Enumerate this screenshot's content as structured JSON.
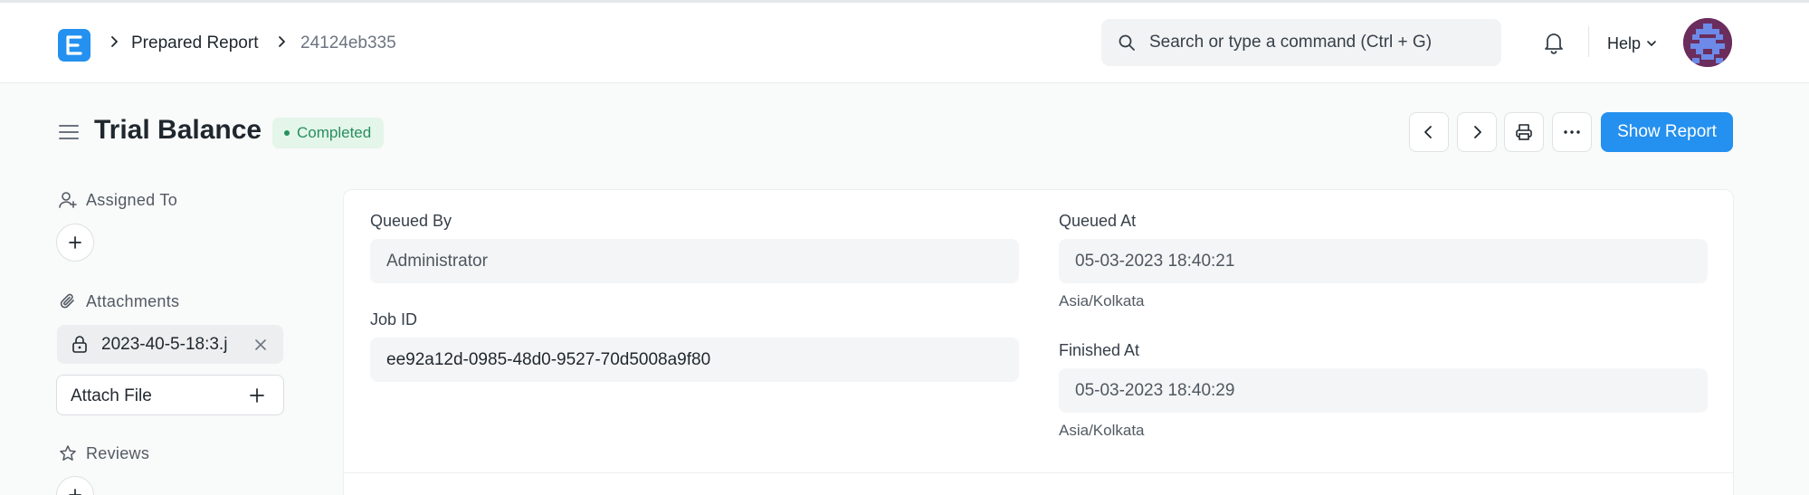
{
  "navbar": {
    "logo_letter": "E",
    "breadcrumbs": [
      "Prepared Report",
      "24124eb335"
    ],
    "search_placeholder": "Search or type a command (Ctrl + G)",
    "help_label": "Help",
    "accent": "#2490ef"
  },
  "page": {
    "title": "Trial Balance",
    "status": "Completed",
    "status_color": "#278f5e",
    "primary_action": "Show Report",
    "toolbar_icons": [
      "chevron-left-icon",
      "chevron-right-icon",
      "printer-icon",
      "more-horizontal-icon"
    ]
  },
  "sidebar": {
    "assigned_to_label": "Assigned To",
    "attachments_label": "Attachments",
    "attachment_name": "2023-40-5-18:3.j",
    "attach_file_label": "Attach File",
    "reviews_label": "Reviews"
  },
  "form": {
    "queued_by_label": "Queued By",
    "queued_by_value": "Administrator",
    "job_id_label": "Job ID",
    "job_id_value": "ee92a12d-0985-48d0-9527-70d5008a9f80",
    "queued_at_label": "Queued At",
    "queued_at_value": "05-03-2023 18:40:21",
    "queued_at_tz": "Asia/Kolkata",
    "finished_at_label": "Finished At",
    "finished_at_value": "05-03-2023 18:40:29",
    "finished_at_tz": "Asia/Kolkata"
  }
}
